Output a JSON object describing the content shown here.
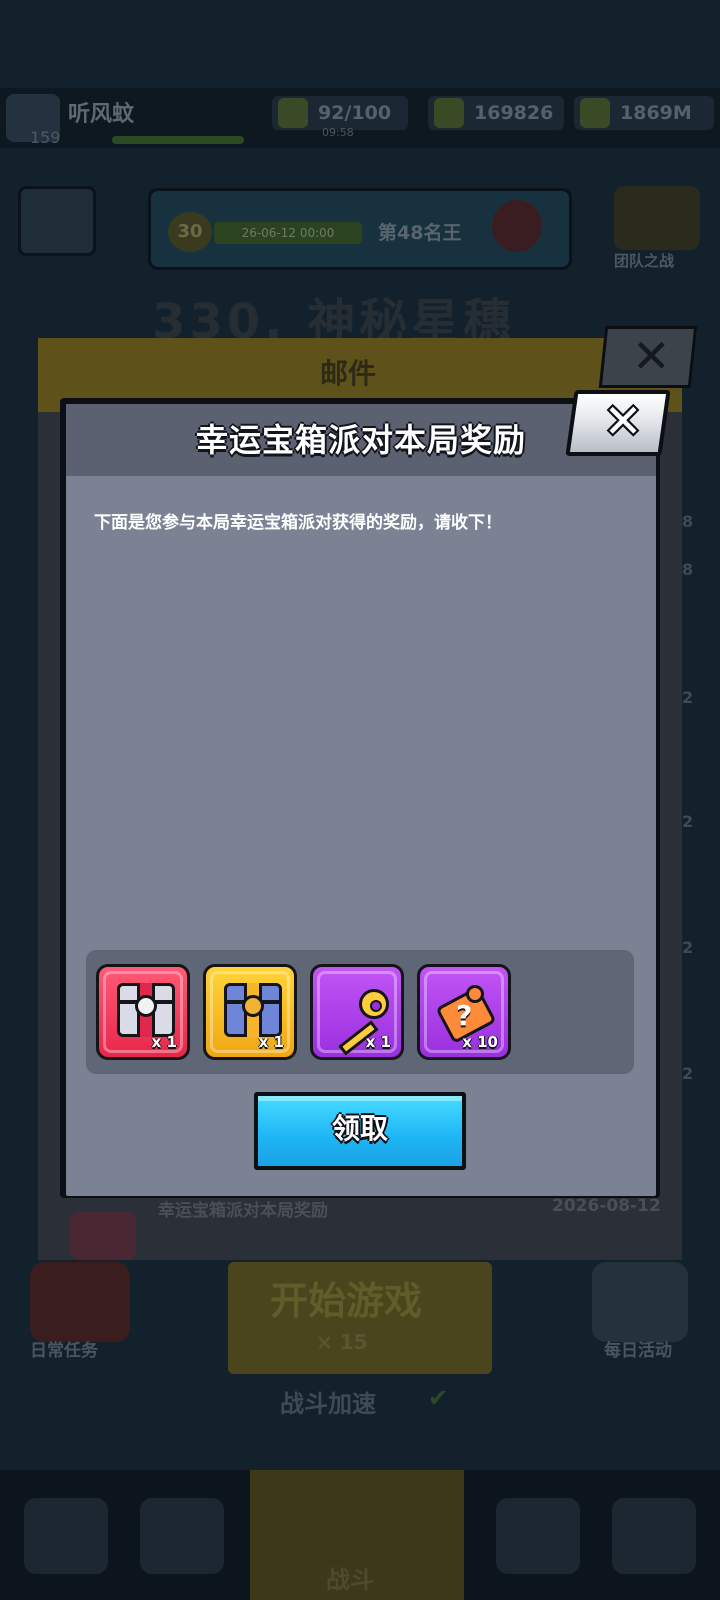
{
  "background": {
    "player": {
      "name": "听风蚊",
      "level_text": "159"
    },
    "resources": [
      {
        "icon": "energy-icon",
        "value": "92/100",
        "sub": "09:58"
      },
      {
        "icon": "coin-icon",
        "value": "169826"
      },
      {
        "icon": "gem-icon",
        "value": "1869M"
      }
    ],
    "stage": {
      "badge": "30",
      "progress_text": "26-06-12 00:00",
      "rank_text": "第48名王"
    },
    "guild_label": "团队之战",
    "stage_title": "330. 神秘星穗",
    "mail": {
      "title": "邮件",
      "row_title": "幸运宝箱派对本局奖励",
      "row_date": "2026-08-12",
      "edge_numbers": [
        "8",
        "8",
        "2",
        "2",
        "2",
        "2"
      ]
    },
    "daily_label": "日常任务",
    "start_button": {
      "label": "开始游戏",
      "cost": "× 15"
    },
    "event_label": "每日活动",
    "speed_label": "战斗加速",
    "nav_center_label": "战斗"
  },
  "dialog": {
    "title": "幸运宝箱派对本局奖励",
    "close_icon": "close-icon",
    "message": "下面是您参与本局幸运宝箱派对获得的奖励，请收下！",
    "rewards": [
      {
        "name": "red-chest",
        "count": "x 1",
        "color": "#e8264b"
      },
      {
        "name": "gold-chest",
        "count": "x 1",
        "color": "#f0a712"
      },
      {
        "name": "golden-key",
        "count": "x 1",
        "color": "#9a2fe0"
      },
      {
        "name": "puzzle-piece",
        "count": "x 10",
        "color": "#9a2fe0"
      }
    ],
    "claim_label": "领取",
    "claim_color": "#1fb6f5"
  }
}
